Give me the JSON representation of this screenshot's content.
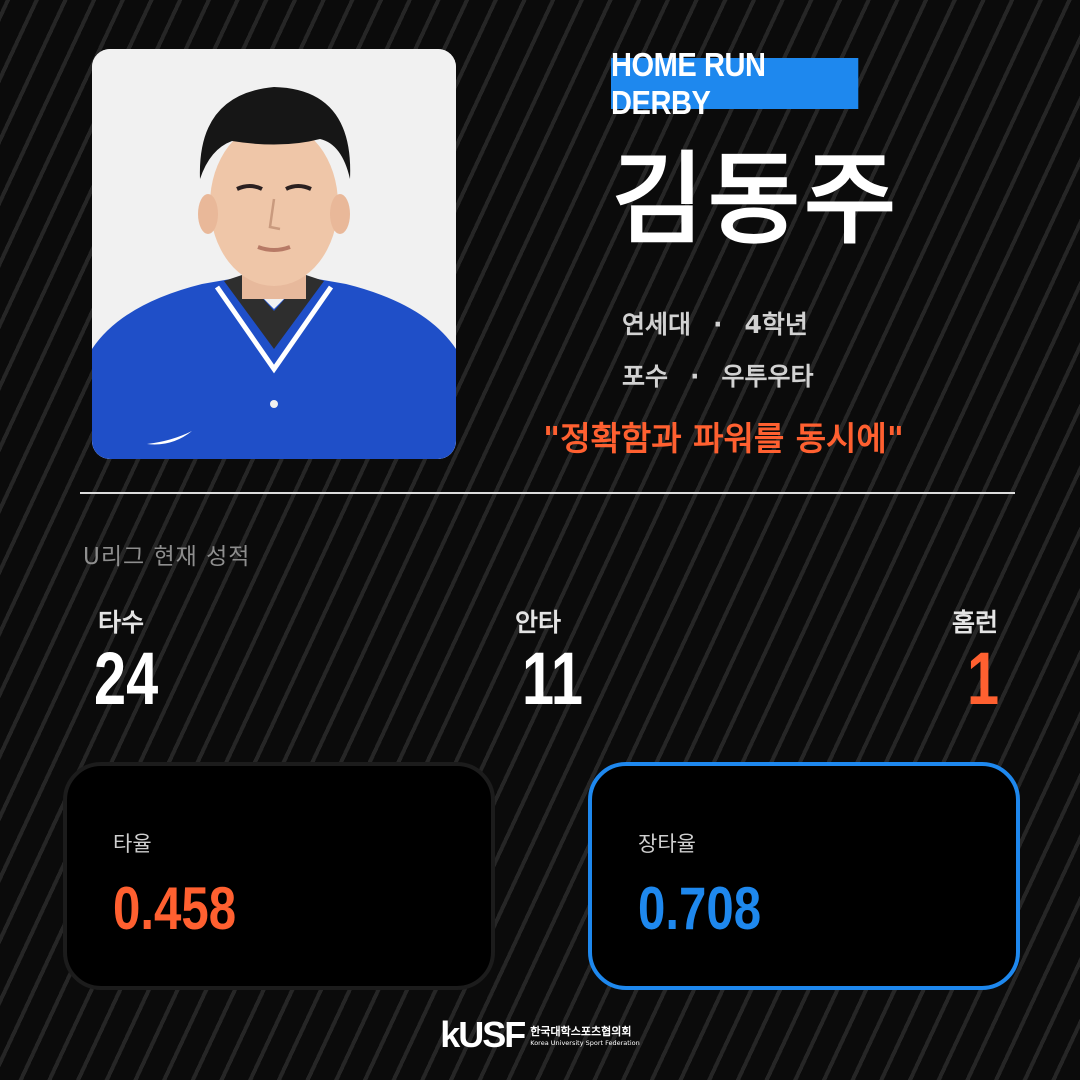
{
  "badge": "HOME RUN DERBY",
  "player": {
    "name": "김동주",
    "school": "연세대",
    "grade": "4학년",
    "position": "포수",
    "bats_throws": "우투우타",
    "separator": "·",
    "motto": "\"정확함과 파워를 동시에\""
  },
  "stats": {
    "section_title": "U리그 현재 성적",
    "at_bats": {
      "label": "타수",
      "value": "24"
    },
    "hits": {
      "label": "안타",
      "value": "11"
    },
    "home_runs": {
      "label": "홈런",
      "value": "1"
    },
    "batting_avg": {
      "label": "타율",
      "value": "0.458"
    },
    "slugging": {
      "label": "장타율",
      "value": "0.708"
    }
  },
  "footer": {
    "logo": "kUSF",
    "org_kr": "한국대학스포츠협의회",
    "org_en": "Korea University Sport Federation"
  },
  "colors": {
    "accent_blue": "#1e88ee",
    "accent_orange": "#ff6030",
    "background": "#0b0b0b"
  }
}
